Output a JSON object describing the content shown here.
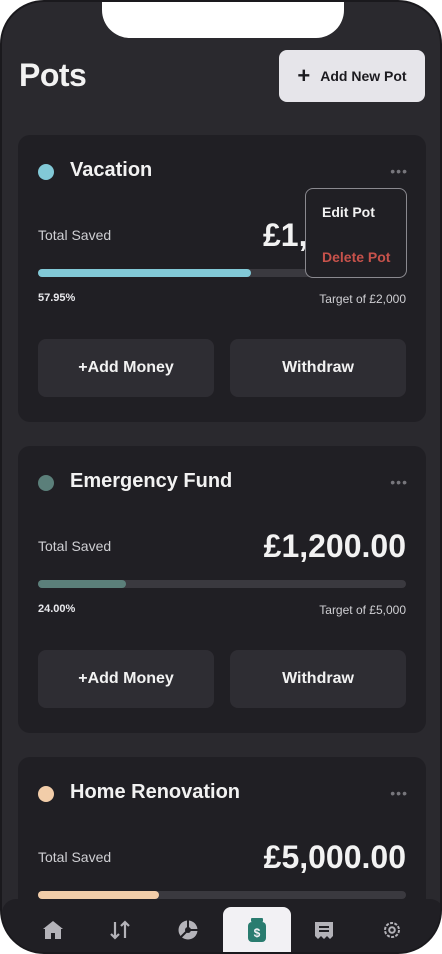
{
  "page": {
    "title": "Pots"
  },
  "header": {
    "add_button_label": "Add New Pot",
    "add_icon": "plus-icon"
  },
  "dropdown": {
    "edit_label": "Edit Pot",
    "delete_label": "Delete Pot"
  },
  "pots": [
    {
      "name": "Vacation",
      "color": "#82c9d7",
      "total_label": "Total Saved",
      "amount": "£1,",
      "progress_percent": 57.95,
      "percent_label": "57.95%",
      "target_label": "Target of £2,000",
      "add_label": "+Add Money",
      "withdraw_label": "Withdraw"
    },
    {
      "name": "Emergency Fund",
      "color": "#5b7f7a",
      "total_label": "Total Saved",
      "amount": "£1,200.00",
      "progress_percent": 24.0,
      "percent_label": "24.00%",
      "target_label": "Target of £5,000",
      "add_label": "+Add Money",
      "withdraw_label": "Withdraw"
    },
    {
      "name": "Home Renovation",
      "color": "#f2cda9",
      "total_label": "Total Saved",
      "amount": "£5,000.00",
      "progress_percent": 33.0
    }
  ],
  "nav": {
    "items": [
      "home-icon",
      "transactions-icon",
      "budgets-icon",
      "pots-icon",
      "bills-icon",
      "settings-icon"
    ],
    "active": "pots-icon",
    "accent": "#2a7c6f"
  }
}
